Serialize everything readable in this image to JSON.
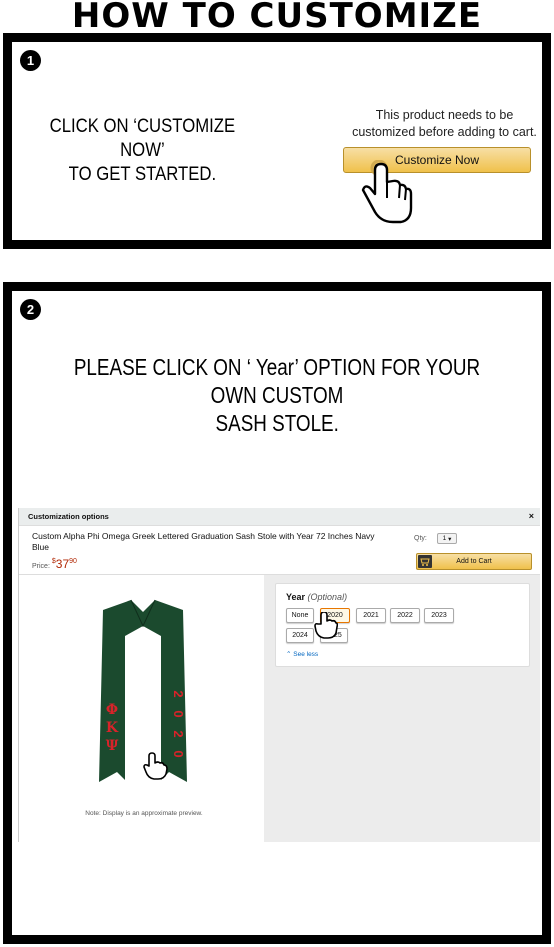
{
  "title": "HOW TO CUSTOMIZE",
  "step1": {
    "number": "1",
    "instruction_line1": "CLICK ON ‘CUSTOMIZE NOW’",
    "instruction_line2": "TO GET STARTED.",
    "note_line1": "This product needs to be",
    "note_line2": "customized before adding to cart.",
    "button_label": "Customize Now"
  },
  "step2": {
    "number": "2",
    "instruction_line1": "PLEASE CLICK ON ‘ Year’ OPTION FOR YOUR OWN CUSTOM",
    "instruction_line2": "SASH STOLE.",
    "dialog": {
      "header": "Customization options",
      "close": "×",
      "product_title": "Custom Alpha Phi Omega Greek Lettered Graduation Sash Stole with Year 72 Inches Navy Blue",
      "price_label": "Price:",
      "price_currency": "$",
      "price_dollars": "37",
      "price_cents": "90",
      "qty_label": "Qty:",
      "qty_value": "1",
      "add_to_cart": "Add to Cart",
      "year_label": "Year",
      "year_optional": "(Optional)",
      "year_options": [
        "None",
        "2020",
        "2021",
        "2022",
        "2023",
        "2024",
        "2025"
      ],
      "selected_year": "2020",
      "see_less": "⌃ See less",
      "preview_note": "Note: Display is an approximate preview.",
      "stole_greek": [
        "Φ",
        "Κ",
        "Ψ"
      ],
      "stole_year": [
        "2",
        "0",
        "2",
        "0"
      ],
      "stole_color": "#1b4a2e",
      "letter_color": "#d8232a"
    }
  },
  "colors": {
    "button_gradient_top": "#f7dfa5",
    "button_gradient_bottom": "#f0c14b",
    "link": "#0066c0",
    "price": "#b12704"
  }
}
